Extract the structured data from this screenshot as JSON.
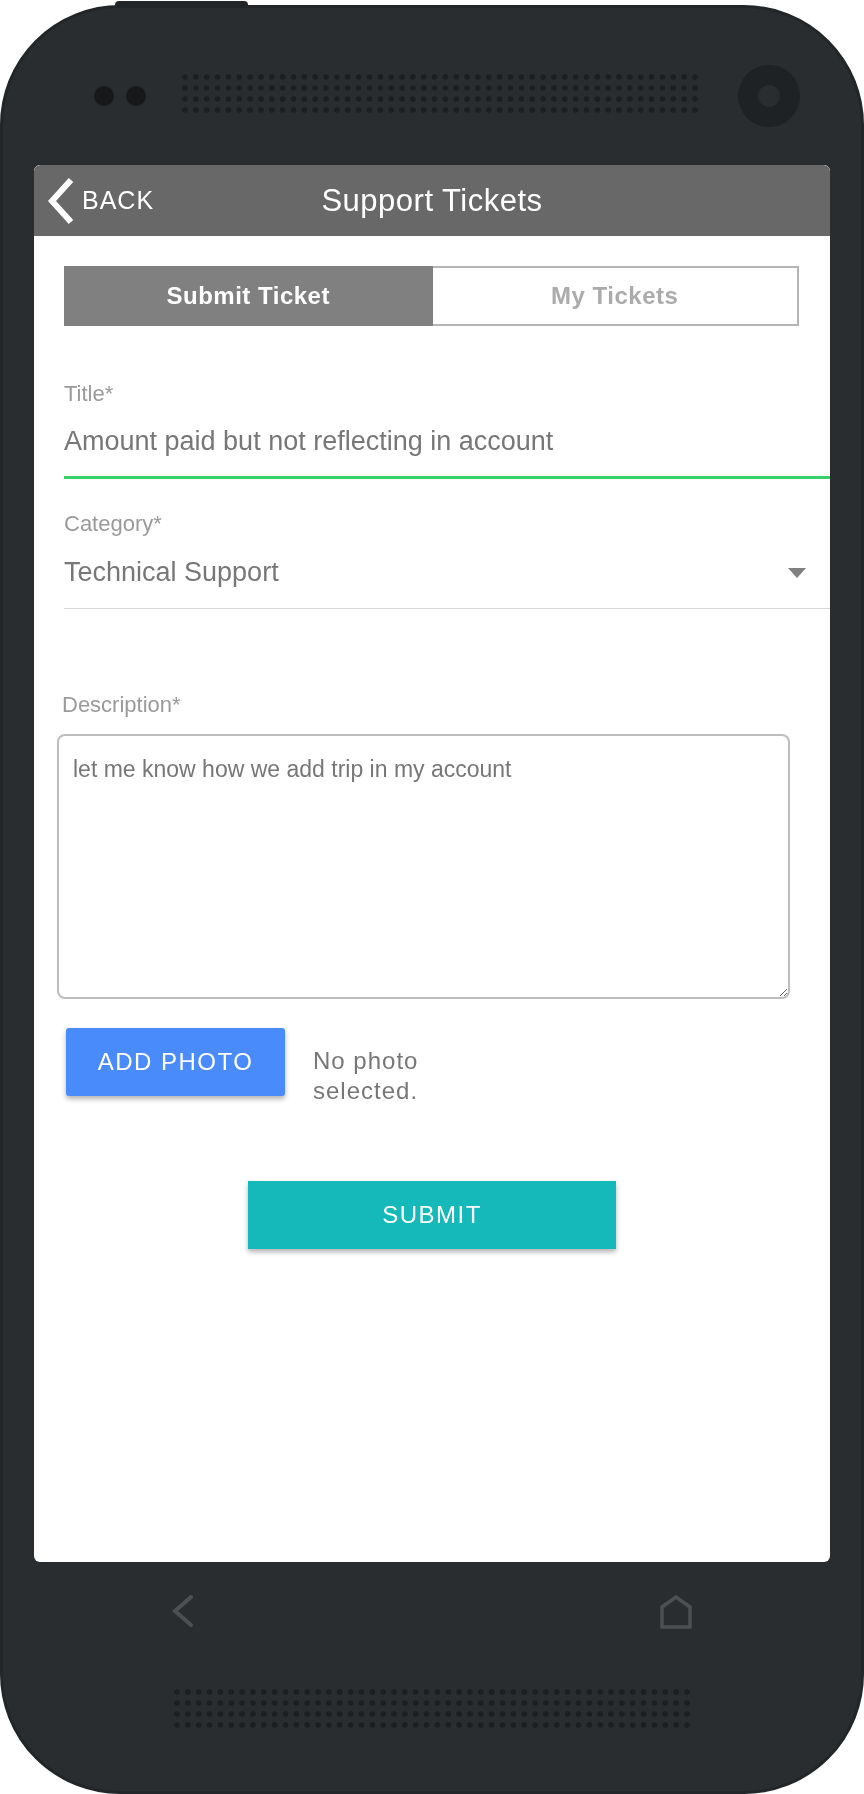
{
  "header": {
    "back_label": "BACK",
    "title": "Support Tickets"
  },
  "tabs": [
    {
      "label": "Submit Ticket",
      "selected": true
    },
    {
      "label": "My Tickets",
      "selected": false
    }
  ],
  "title_field": {
    "label": "Title*",
    "value": "Amount paid but not reflecting in account",
    "focused": true
  },
  "category_field": {
    "label": "Category*",
    "value": "Technical Support",
    "focused": false
  },
  "description_field": {
    "label": "Description*",
    "value": "let me know how we add trip in my account"
  },
  "add_photo_button": "ADD PHOTO",
  "photo_status": "No photo selected.",
  "submit_button": "SUBMIT"
}
